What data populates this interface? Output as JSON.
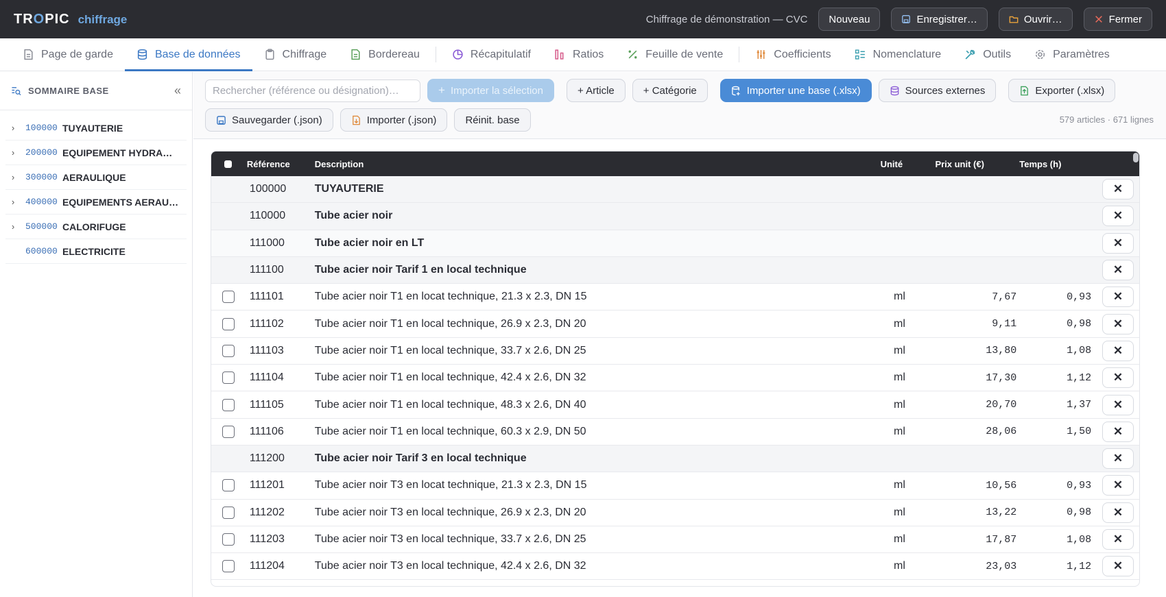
{
  "app": {
    "logo_left": "TR",
    "logo_o": "O",
    "logo_right": "PIC",
    "logo_sub": "chiffrage"
  },
  "header": {
    "project_title": "Chiffrage de démonstration — CVC",
    "buttons": {
      "new": "Nouveau",
      "save": "Enregistrer…",
      "open": "Ouvrir…",
      "close": "Fermer"
    }
  },
  "tabs": [
    {
      "label": "Page de garde",
      "icon": "document-icon"
    },
    {
      "label": "Base de données",
      "icon": "database-icon",
      "active": true
    },
    {
      "label": "Chiffrage",
      "icon": "clipboard-icon"
    },
    {
      "label": "Bordereau",
      "icon": "file-icon"
    },
    {
      "label": "Récapitulatif",
      "icon": "pie-icon"
    },
    {
      "label": "Ratios",
      "icon": "bars-icon"
    },
    {
      "label": "Feuille de vente",
      "icon": "percent-icon"
    },
    {
      "label": "Coefficients",
      "icon": "sliders-icon"
    },
    {
      "label": "Nomenclature",
      "icon": "list-icon"
    },
    {
      "label": "Outils",
      "icon": "tools-icon"
    },
    {
      "label": "Paramètres",
      "icon": "gear-icon"
    }
  ],
  "sidebar": {
    "title": "SOMMAIRE BASE",
    "items": [
      {
        "code": "100000",
        "label": "TUYAUTERIE",
        "expandable": true
      },
      {
        "code": "200000",
        "label": "EQUIPEMENT HYDRAULI…",
        "expandable": true
      },
      {
        "code": "300000",
        "label": "AERAULIQUE",
        "expandable": true
      },
      {
        "code": "400000",
        "label": "EQUIPEMENTS AERAULI…",
        "expandable": true
      },
      {
        "code": "500000",
        "label": "CALORIFUGE",
        "expandable": true
      },
      {
        "code": "600000",
        "label": "ELECTRICITE",
        "expandable": false
      }
    ]
  },
  "toolbar": {
    "search_placeholder": "Rechercher (référence ou désignation)…",
    "import_selection": "Importer la sélection",
    "add_article": "+ Article",
    "add_category": "+ Catégorie",
    "import_base": "Importer une base (.xlsx)",
    "external_sources": "Sources externes",
    "export": "Exporter (.xlsx)",
    "save_json": "Sauvegarder (.json)",
    "import_json": "Importer (.json)",
    "reset": "Réinit. base",
    "count": "579 articles · 671 lignes"
  },
  "table": {
    "headers": {
      "ref": "Référence",
      "desc": "Description",
      "unit": "Unité",
      "price": "Prix unit (€)",
      "time": "Temps (h)"
    },
    "rows": [
      {
        "ref": "100000",
        "desc": "TUYAUTERIE",
        "cat": true,
        "unit": "",
        "price": "",
        "time": ""
      },
      {
        "ref": "110000",
        "desc": "Tube acier noir",
        "cat": true,
        "unit": "",
        "price": "",
        "time": ""
      },
      {
        "ref": "111000",
        "desc": "Tube acier noir en LT",
        "cat": true,
        "light": true,
        "unit": "",
        "price": "",
        "time": ""
      },
      {
        "ref": "111100",
        "desc": "Tube acier noir Tarif 1 en local technique",
        "cat": true,
        "unit": "",
        "price": "",
        "time": ""
      },
      {
        "ref": "111101",
        "desc": "Tube acier noir T1 en locat technique, 21.3 x 2.3, DN 15",
        "unit": "ml",
        "price": "7,67",
        "time": "0,93"
      },
      {
        "ref": "111102",
        "desc": "Tube acier noir T1 en local technique, 26.9 x 2.3, DN 20",
        "unit": "ml",
        "price": "9,11",
        "time": "0,98"
      },
      {
        "ref": "111103",
        "desc": "Tube acier noir T1 en local technique, 33.7 x 2.6, DN 25",
        "unit": "ml",
        "price": "13,80",
        "time": "1,08"
      },
      {
        "ref": "111104",
        "desc": "Tube acier noir T1 en local technique, 42.4 x 2.6, DN 32",
        "unit": "ml",
        "price": "17,30",
        "time": "1,12"
      },
      {
        "ref": "111105",
        "desc": "Tube acier noir T1 en local technique, 48.3 x 2.6, DN 40",
        "unit": "ml",
        "price": "20,70",
        "time": "1,37"
      },
      {
        "ref": "111106",
        "desc": "Tube acier noir T1 en local technique, 60.3 x 2.9, DN 50",
        "unit": "ml",
        "price": "28,06",
        "time": "1,50"
      },
      {
        "ref": "111200",
        "desc": "Tube acier noir Tarif 3 en local technique",
        "cat": true,
        "unit": "",
        "price": "",
        "time": ""
      },
      {
        "ref": "111201",
        "desc": "Tube acier noir T3 en locat technique, 21.3 x 2.3, DN 15",
        "unit": "ml",
        "price": "10,56",
        "time": "0,93"
      },
      {
        "ref": "111202",
        "desc": "Tube acier noir T3 en local technique, 26.9 x 2.3, DN 20",
        "unit": "ml",
        "price": "13,22",
        "time": "0,98"
      },
      {
        "ref": "111203",
        "desc": "Tube acier noir T3 en local technique, 33.7 x 2.6, DN 25",
        "unit": "ml",
        "price": "17,87",
        "time": "1,08"
      },
      {
        "ref": "111204",
        "desc": "Tube acier noir T3 en local technique, 42.4 x 2.6, DN 32",
        "unit": "ml",
        "price": "23,03",
        "time": "1,12"
      }
    ]
  },
  "colors": {
    "accent": "#3b78c4",
    "topbar": "#2b2c31",
    "primary_button": "#4a8bd6"
  }
}
